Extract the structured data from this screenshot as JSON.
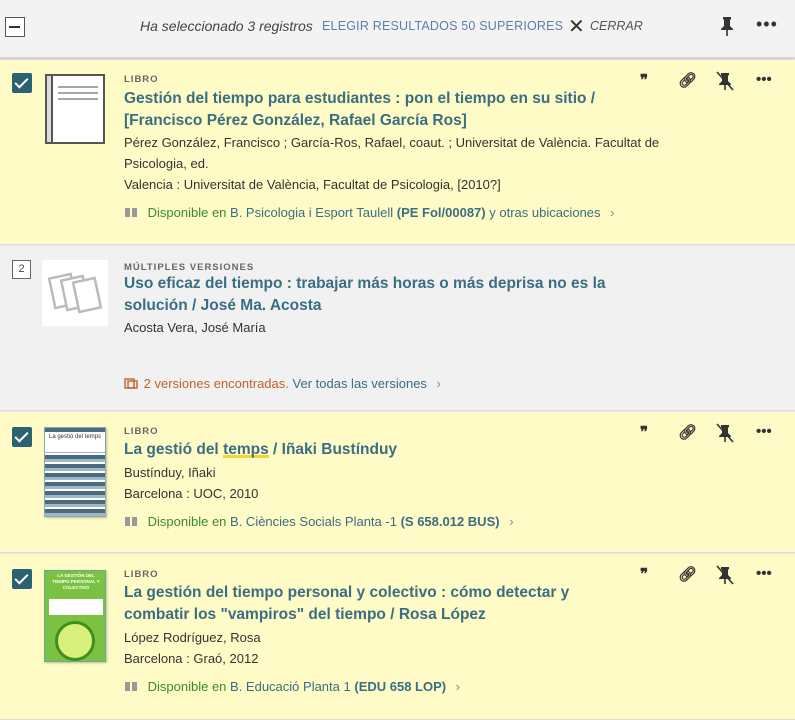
{
  "topbar": {
    "selected_text": "Ha seleccionado 3 registros",
    "top50_label": "ELEGIR RESULTADOS 50 SUPERIORES",
    "close_label": "CERRAR"
  },
  "records": [
    {
      "type": "LIBRO",
      "title1": "Gestión del tiempo para estudiantes : pon el tiempo en su sitio /",
      "title2": "[Francisco Pérez González, Rafael García Ros]",
      "authors1": "Pérez González, Francisco ; García-Ros, Rafael, coaut. ; Universitat de València. Facultat de",
      "authors2": "Psicologia, ed.",
      "publisher": "Valencia : Universitat de València, Facultat de Psicologia, [2010?]",
      "avail_status": "Disponible en",
      "avail_library": "B. Psicologia i Esport  Taulell",
      "avail_call": "(PE Fol/00087)",
      "avail_more": "y otras ubicaciones"
    },
    {
      "number": "2",
      "type": "MÚLTIPLES VERSIONES",
      "title1": "Uso eficaz del tiempo : trabajar más horas o más deprisa no es la",
      "title2": "solución / José Ma. Acosta",
      "authors1": "Acosta Vera, José María",
      "versions_text": "2 versiones encontradas.",
      "versions_link": "Ver todas las versiones"
    },
    {
      "type": "LIBRO",
      "title_pre": "La gestió del ",
      "title_hl": "temps",
      "title_post": " / Iñaki Bustínduy",
      "authors1": "Bustínduy, Iñaki",
      "publisher": "Barcelona : UOC, 2010",
      "avail_status": "Disponible en",
      "avail_library": "B. Ciències Socials  Planta -1",
      "avail_call": "(S 658.012 BUS)",
      "cover_title": "La gestió del temps"
    },
    {
      "type": "LIBRO",
      "title1": "La gestión del tiempo personal y colectivo : cómo detectar y",
      "title2": "combatir los \"vampiros\" del tiempo / Rosa López",
      "authors1": "López Rodríguez, Rosa",
      "publisher": "Barcelona : Graó, 2012",
      "avail_status": "Disponible en",
      "avail_library": "B. Educació  Planta 1",
      "avail_call": "(EDU 658 LOP)",
      "cover_title": "LA GESTIÓN DEL TIEMPO PERSONAL Y COLECTIVO"
    }
  ],
  "icons": {
    "cite": "quote-icon",
    "link": "link-icon",
    "pin": "pin-icon",
    "more": "more-icon"
  },
  "colors": {
    "selected_bg": "#fffbc7",
    "accent": "#3a6e82",
    "available": "#3b8b2b",
    "versions": "#c0612b"
  }
}
